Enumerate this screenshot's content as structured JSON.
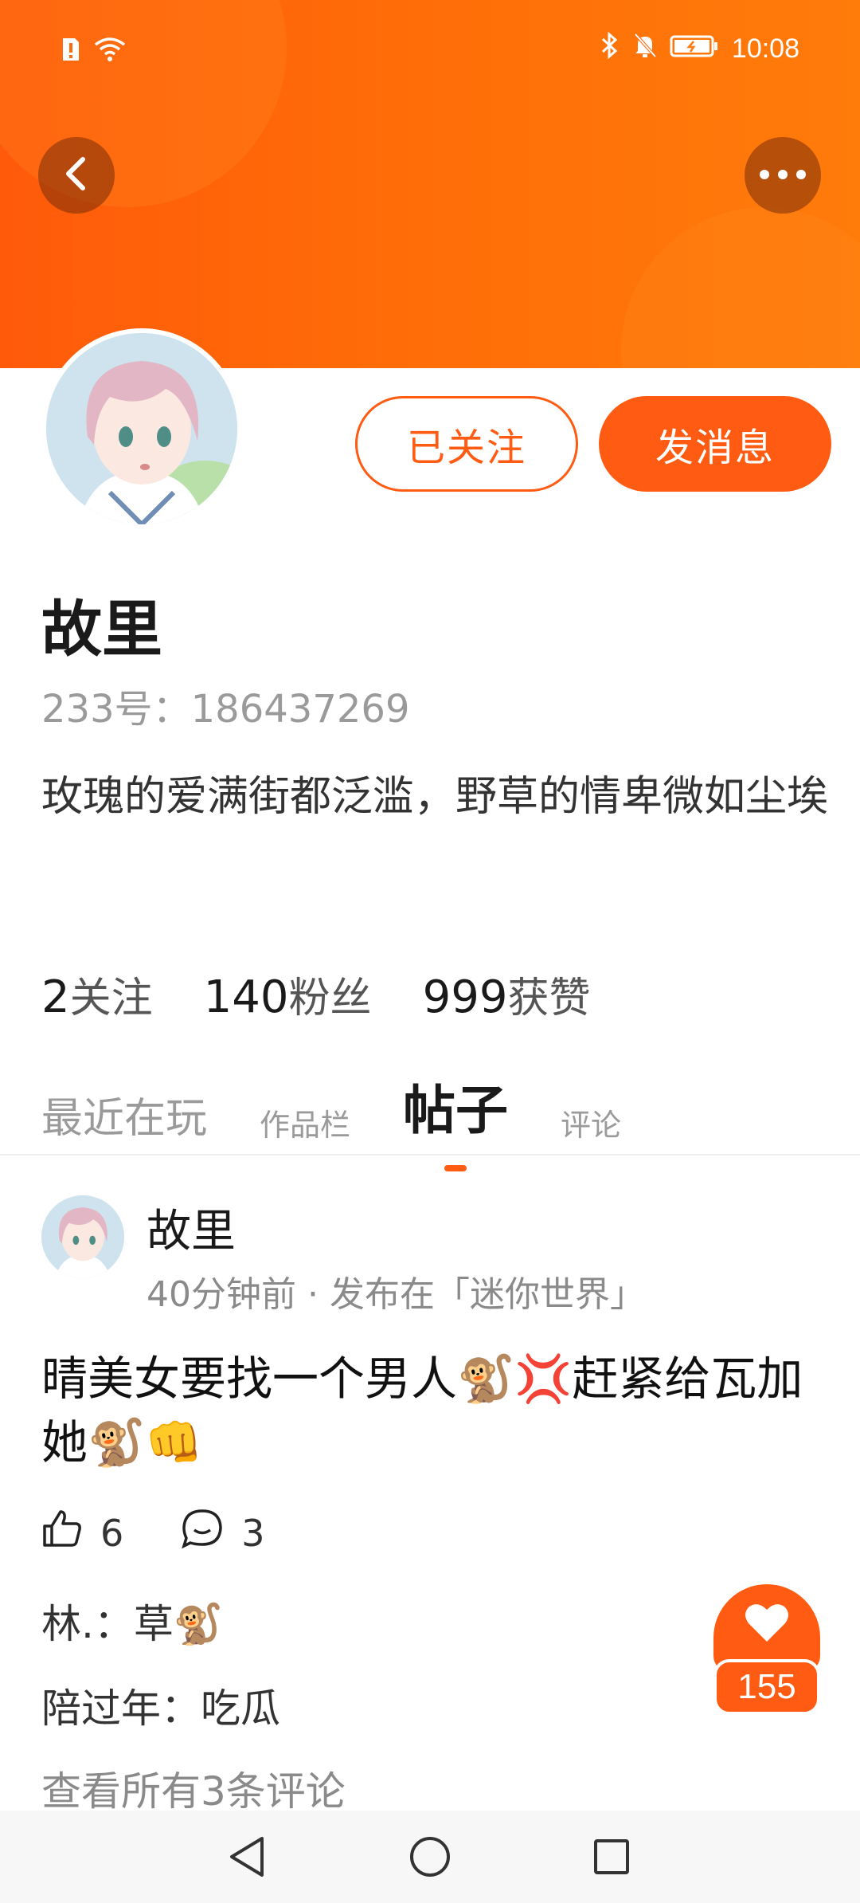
{
  "status_bar": {
    "time": "10:08"
  },
  "header": {
    "back_icon": "chevron-left-icon",
    "more_icon": "more-horizontal-icon"
  },
  "profile": {
    "followed_label": "已关注",
    "message_label": "发消息",
    "name": "故里",
    "uid_label": "233号：",
    "uid": "186437269",
    "bio": "玫瑰的爱满街都泛滥，野草的情卑微如尘埃",
    "stats": [
      {
        "num": "2",
        "label": "关注"
      },
      {
        "num": "140",
        "label": "粉丝"
      },
      {
        "num": "999",
        "label": "获赞"
      }
    ]
  },
  "tabs": [
    {
      "label": "最近在玩"
    },
    {
      "label": "作品栏"
    },
    {
      "label": "帖子"
    },
    {
      "label": "评论"
    }
  ],
  "post": {
    "author": "故里",
    "meta": "40分钟前 · 发布在「迷你世界」",
    "content": "晴美女要找一个男人🐒💢赶紧给瓦加她🐒👊",
    "likes": "6",
    "comments_count": "3",
    "comments": [
      {
        "user": "林.：",
        "text": "草🐒"
      },
      {
        "user": "陪过年：",
        "text": "吃瓜"
      }
    ],
    "view_all": "查看所有3条评论"
  },
  "fab": {
    "count": "155"
  },
  "colors": {
    "accent": "#ff5b12",
    "header_start": "#ff5a0a",
    "header_end": "#ff7b0a"
  }
}
